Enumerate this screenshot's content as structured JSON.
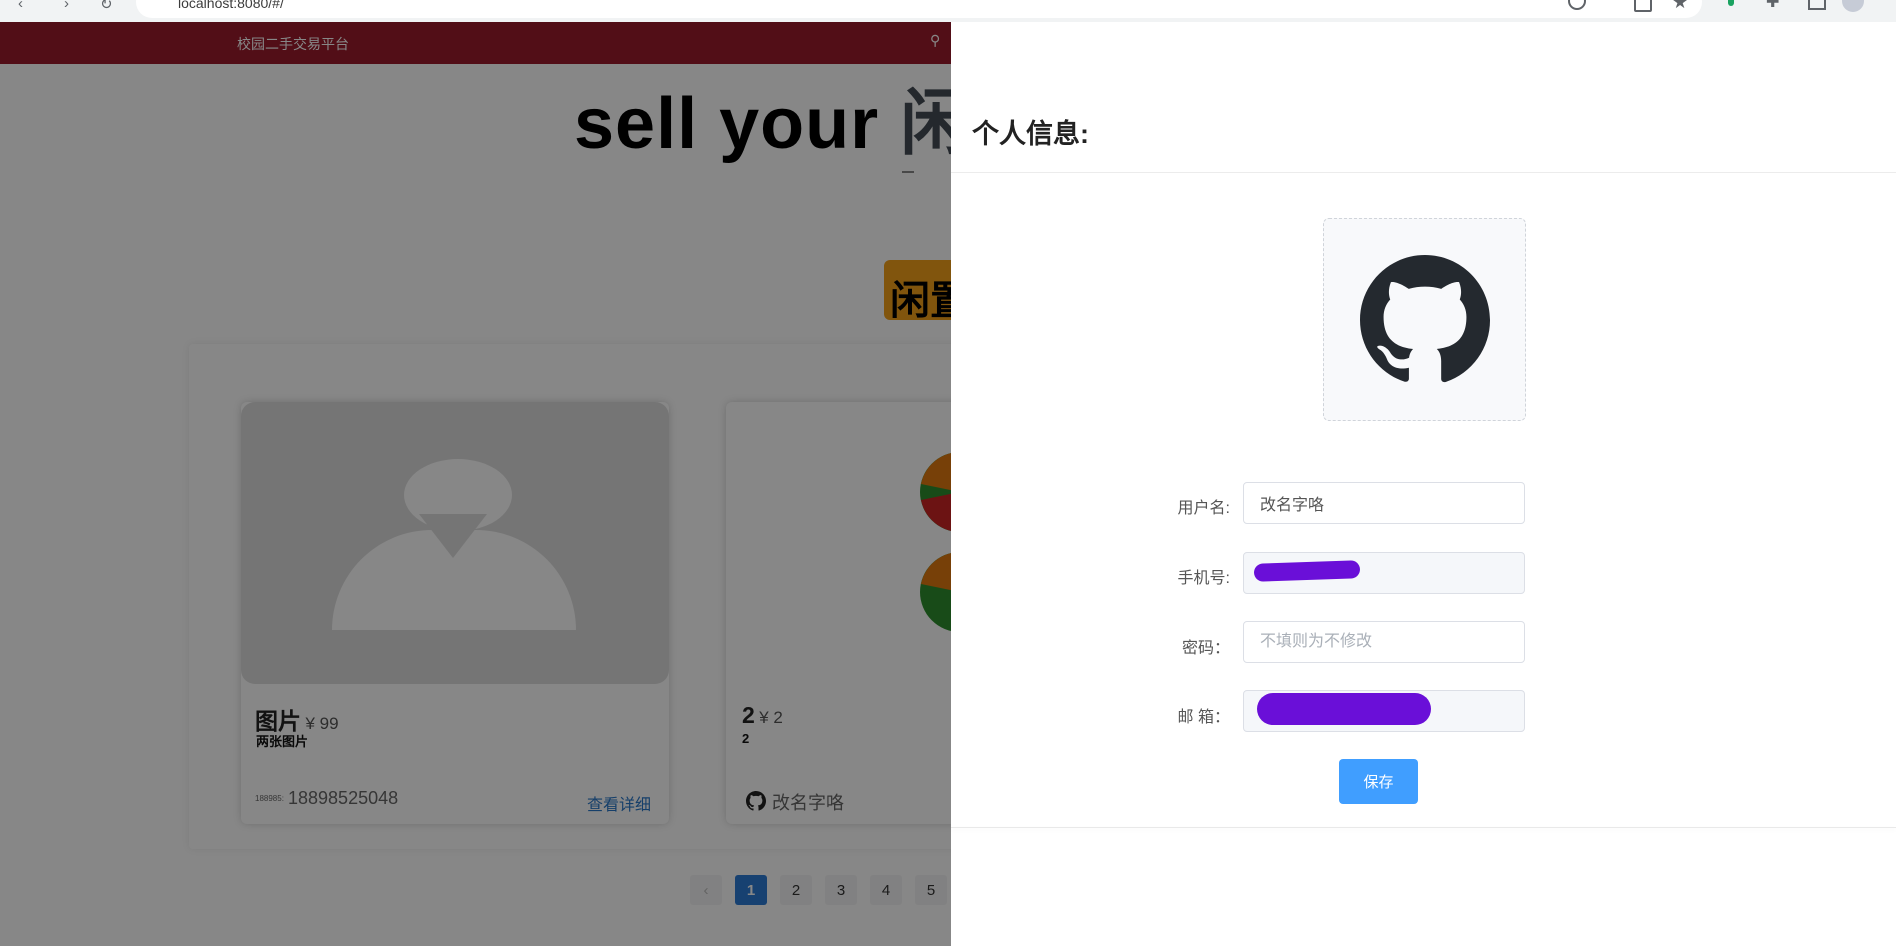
{
  "browser": {
    "url": "localhost:8080/#/",
    "back_glyph": "‹",
    "forward_glyph": "›",
    "reload_glyph": "↻"
  },
  "nav": {
    "title": "校园二手交易平台",
    "bike_icon": "⚲"
  },
  "hero": {
    "text": "sell your ",
    "accent": "闲"
  },
  "tag": {
    "text": "闲置"
  },
  "cards": [
    {
      "name": "图片",
      "price": "¥ 99",
      "desc": "两张图片",
      "seller_small": "188985:",
      "seller_phone": "18898525048",
      "detail_link": "查看详细"
    },
    {
      "name": "2",
      "price": "¥ 2",
      "desc": "2",
      "seller_name": "改名字咯"
    }
  ],
  "pager": {
    "prev": "‹",
    "pages": [
      "1",
      "2",
      "3",
      "4",
      "5"
    ],
    "active": "1"
  },
  "drawer": {
    "title": "个人信息:",
    "fields": {
      "username": {
        "label": "用户名:",
        "value": "改名字咯"
      },
      "phone": {
        "label": "手机号:",
        "value": ""
      },
      "password": {
        "label": "密码：",
        "placeholder": "不填则为不修改"
      },
      "email": {
        "label": "邮 箱：",
        "value": ""
      }
    },
    "save_label": "保存"
  },
  "colors": {
    "nav_bg": "#9c1c2c",
    "primary": "#409eff",
    "redaction": "#6a0fd8",
    "tag_bg": "#f4a11a"
  },
  "icons": {
    "avatar": "github-icon",
    "seller": "github-icon"
  }
}
